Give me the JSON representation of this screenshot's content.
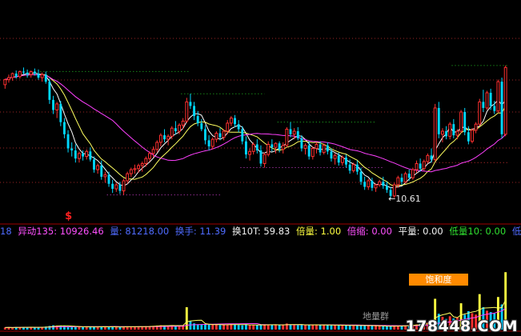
{
  "indicator_row": [
    {
      "name": "cut-prefix",
      "text": "18",
      "color": "#4f6bff"
    },
    {
      "name": "yidong-135",
      "text": "异动135: 10926.46",
      "color": "#ff50ff"
    },
    {
      "name": "volume-value",
      "text": "量: 81218.00",
      "color": "#4f6bff"
    },
    {
      "name": "turnover-value",
      "text": "换手: 11.39",
      "color": "#4f6bff"
    },
    {
      "name": "turnover-10t",
      "text": "换10T: 59.83",
      "color": "#f2f2f2"
    },
    {
      "name": "double-volume",
      "text": "倍量: 1.00",
      "color": "#ffff40"
    },
    {
      "name": "double-shrink",
      "text": "倍缩: 0.00",
      "color": "#ff50ff"
    },
    {
      "name": "flat-volume",
      "text": "平量: 0.00",
      "color": "#f2f2f2"
    },
    {
      "name": "low-volume-10",
      "text": "低量10: 0.00",
      "color": "#30e030"
    },
    {
      "name": "low-volume",
      "text": "低量",
      "color": "#4f6bff"
    }
  ],
  "annotations": {
    "low_price_label": "←10.61",
    "saturation_badge": "饱和度",
    "volume_group_label": "地量群",
    "signal_marker": "$",
    "watermark": "178448.COM"
  },
  "colors": {
    "up": "#ff3030",
    "down": "#00d8ff",
    "ma_short": "#ffffff",
    "ma_mid": "#ffff60",
    "ma_long": "#ff40ff",
    "dotted_green": "#22c022",
    "dotted_magenta": "#d040d0",
    "dotted_red": "#d03030",
    "divider": "#a00000",
    "volume_up": "#ff3030",
    "volume_down": "#00c8ff",
    "volume_highlight": "#ffff40",
    "volume_low_line": "#ff40ff",
    "volume_mid_line": "#ffff60"
  },
  "chart_data": {
    "type": "candlestick",
    "title": "",
    "xlabel": "",
    "ylabel": "",
    "ylim": [
      9.6,
      20.2
    ],
    "candles": [
      [
        16.25,
        16.55,
        16.05,
        16.5
      ],
      [
        16.5,
        16.75,
        16.35,
        16.6
      ],
      [
        16.6,
        16.85,
        16.45,
        16.8
      ],
      [
        16.8,
        16.95,
        16.55,
        16.65
      ],
      [
        16.65,
        16.95,
        16.55,
        16.9
      ],
      [
        16.9,
        17.1,
        16.75,
        16.85
      ],
      [
        16.85,
        17.0,
        16.6,
        16.75
      ],
      [
        16.75,
        16.95,
        16.6,
        16.9
      ],
      [
        16.9,
        17.05,
        16.7,
        16.8
      ],
      [
        16.8,
        17.0,
        16.5,
        16.6
      ],
      [
        16.6,
        16.85,
        16.4,
        16.75
      ],
      [
        16.75,
        16.9,
        16.3,
        16.4
      ],
      [
        16.4,
        16.55,
        15.3,
        15.5
      ],
      [
        15.5,
        15.7,
        14.8,
        15.0
      ],
      [
        15.0,
        15.4,
        14.6,
        15.3
      ],
      [
        15.3,
        15.45,
        14.2,
        14.4
      ],
      [
        14.4,
        14.6,
        13.6,
        13.8
      ],
      [
        13.8,
        14.0,
        12.9,
        13.1
      ],
      [
        13.1,
        13.4,
        12.7,
        13.0
      ],
      [
        13.0,
        13.3,
        12.4,
        12.6
      ],
      [
        12.6,
        12.95,
        12.4,
        12.85
      ],
      [
        12.85,
        13.0,
        12.5,
        12.7
      ],
      [
        12.7,
        13.05,
        12.55,
        12.95
      ],
      [
        12.95,
        13.15,
        12.45,
        12.55
      ],
      [
        12.55,
        12.7,
        11.9,
        12.05
      ],
      [
        12.05,
        12.35,
        11.85,
        12.25
      ],
      [
        12.25,
        12.5,
        11.55,
        11.7
      ],
      [
        11.7,
        11.95,
        11.4,
        11.8
      ],
      [
        11.8,
        11.95,
        11.2,
        11.35
      ],
      [
        11.35,
        11.55,
        10.9,
        11.1
      ],
      [
        11.1,
        11.4,
        10.95,
        11.3
      ],
      [
        11.3,
        11.45,
        10.85,
        11.0
      ],
      [
        11.0,
        11.6,
        10.8,
        11.5
      ],
      [
        11.5,
        11.95,
        11.35,
        11.85
      ],
      [
        11.85,
        12.15,
        11.7,
        12.05
      ],
      [
        12.05,
        12.3,
        11.85,
        12.1
      ],
      [
        12.1,
        12.35,
        11.9,
        12.25
      ],
      [
        12.25,
        12.45,
        11.95,
        12.35
      ],
      [
        12.35,
        12.7,
        12.2,
        12.6
      ],
      [
        12.6,
        12.95,
        12.45,
        12.85
      ],
      [
        12.85,
        13.2,
        12.65,
        13.05
      ],
      [
        13.05,
        13.5,
        12.9,
        13.4
      ],
      [
        13.4,
        13.85,
        13.2,
        13.75
      ],
      [
        13.75,
        14.05,
        13.4,
        13.55
      ],
      [
        13.55,
        13.8,
        13.25,
        13.7
      ],
      [
        13.7,
        14.2,
        13.55,
        14.1
      ],
      [
        14.1,
        14.45,
        13.8,
        13.95
      ],
      [
        13.95,
        14.35,
        13.8,
        14.25
      ],
      [
        14.25,
        14.6,
        14.05,
        14.45
      ],
      [
        14.45,
        15.6,
        14.35,
        15.4
      ],
      [
        15.4,
        15.8,
        15.05,
        15.2
      ],
      [
        15.2,
        15.4,
        14.5,
        14.7
      ],
      [
        14.7,
        14.95,
        14.2,
        14.35
      ],
      [
        14.35,
        14.55,
        13.95,
        14.05
      ],
      [
        14.05,
        14.25,
        13.3,
        13.5
      ],
      [
        13.5,
        13.75,
        13.0,
        13.2
      ],
      [
        13.2,
        13.65,
        13.05,
        13.55
      ],
      [
        13.55,
        13.95,
        13.4,
        13.85
      ],
      [
        13.85,
        14.1,
        13.5,
        13.65
      ],
      [
        13.65,
        14.05,
        13.5,
        13.95
      ],
      [
        13.95,
        14.5,
        13.8,
        14.35
      ],
      [
        14.35,
        14.7,
        14.2,
        14.6
      ],
      [
        14.6,
        14.75,
        14.15,
        14.3
      ],
      [
        14.3,
        14.5,
        13.9,
        14.05
      ],
      [
        14.05,
        14.2,
        13.3,
        13.45
      ],
      [
        13.45,
        13.7,
        12.6,
        12.8
      ],
      [
        12.8,
        13.1,
        12.5,
        12.95
      ],
      [
        12.95,
        13.4,
        12.8,
        13.3
      ],
      [
        13.3,
        13.55,
        12.85,
        13.0
      ],
      [
        13.0,
        13.25,
        12.2,
        12.35
      ],
      [
        12.35,
        12.9,
        12.15,
        12.8
      ],
      [
        12.8,
        13.45,
        12.7,
        13.3
      ],
      [
        13.3,
        13.55,
        12.95,
        13.15
      ],
      [
        13.15,
        13.4,
        12.85,
        13.35
      ],
      [
        13.35,
        13.45,
        12.9,
        13.05
      ],
      [
        13.05,
        13.4,
        12.85,
        13.25
      ],
      [
        13.25,
        14.15,
        13.15,
        14.05
      ],
      [
        14.05,
        14.4,
        13.65,
        13.8
      ],
      [
        13.8,
        14.1,
        13.55,
        13.95
      ],
      [
        13.95,
        14.15,
        13.5,
        13.6
      ],
      [
        13.6,
        13.75,
        12.95,
        13.1
      ],
      [
        13.1,
        13.35,
        12.8,
        13.25
      ],
      [
        13.25,
        13.45,
        12.55,
        12.7
      ],
      [
        12.7,
        13.2,
        12.55,
        13.1
      ],
      [
        13.1,
        13.4,
        12.85,
        13.3
      ],
      [
        13.3,
        13.45,
        12.75,
        12.9
      ],
      [
        12.9,
        13.35,
        12.8,
        13.25
      ],
      [
        13.25,
        13.4,
        12.8,
        12.95
      ],
      [
        12.95,
        13.1,
        12.45,
        12.6
      ],
      [
        12.6,
        12.85,
        12.3,
        12.75
      ],
      [
        12.75,
        12.9,
        12.25,
        12.4
      ],
      [
        12.4,
        12.75,
        12.25,
        12.65
      ],
      [
        12.65,
        12.8,
        12.15,
        12.3
      ],
      [
        12.3,
        12.55,
        11.85,
        12.0
      ],
      [
        12.0,
        12.4,
        11.9,
        12.3
      ],
      [
        12.3,
        12.5,
        11.8,
        11.95
      ],
      [
        11.95,
        12.15,
        11.3,
        11.45
      ],
      [
        11.45,
        11.7,
        11.05,
        11.2
      ],
      [
        11.2,
        11.6,
        11.05,
        11.5
      ],
      [
        11.5,
        11.65,
        11.0,
        11.15
      ],
      [
        11.15,
        11.35,
        10.95,
        11.3
      ],
      [
        11.3,
        11.55,
        11.2,
        11.45
      ],
      [
        11.45,
        11.7,
        11.1,
        11.25
      ],
      [
        11.25,
        11.45,
        10.9,
        11.05
      ],
      [
        11.05,
        11.2,
        10.61,
        10.75
      ],
      [
        10.75,
        11.4,
        10.65,
        11.3
      ],
      [
        11.3,
        11.75,
        11.15,
        11.65
      ],
      [
        11.65,
        11.85,
        11.3,
        11.45
      ],
      [
        11.45,
        11.95,
        11.35,
        11.85
      ],
      [
        11.85,
        12.05,
        11.5,
        11.65
      ],
      [
        11.65,
        12.15,
        11.55,
        12.05
      ],
      [
        12.05,
        12.5,
        11.9,
        12.35
      ],
      [
        12.35,
        12.6,
        11.95,
        12.1
      ],
      [
        12.1,
        12.55,
        12.0,
        12.45
      ],
      [
        12.45,
        12.85,
        12.35,
        12.75
      ],
      [
        12.75,
        13.1,
        12.4,
        12.55
      ],
      [
        12.55,
        15.3,
        12.45,
        15.1
      ],
      [
        15.1,
        15.4,
        13.6,
        13.8
      ],
      [
        13.8,
        14.1,
        13.4,
        13.95
      ],
      [
        13.95,
        14.2,
        13.55,
        13.7
      ],
      [
        13.7,
        14.4,
        13.55,
        14.3
      ],
      [
        14.3,
        14.55,
        13.6,
        13.75
      ],
      [
        13.75,
        14.05,
        13.55,
        13.95
      ],
      [
        13.95,
        15.0,
        13.85,
        14.9
      ],
      [
        14.9,
        15.1,
        13.75,
        13.9
      ],
      [
        13.9,
        14.2,
        13.3,
        13.45
      ],
      [
        13.45,
        14.1,
        13.35,
        14.0
      ],
      [
        14.0,
        14.4,
        13.85,
        14.3
      ],
      [
        14.3,
        15.55,
        14.2,
        15.4
      ],
      [
        15.4,
        16.0,
        14.9,
        15.1
      ],
      [
        15.1,
        15.95,
        15.0,
        15.85
      ],
      [
        15.85,
        16.05,
        15.0,
        15.2
      ],
      [
        15.2,
        15.45,
        14.8,
        14.95
      ],
      [
        14.95,
        16.5,
        14.85,
        16.4
      ],
      [
        16.4,
        16.6,
        13.6,
        13.8
      ],
      [
        13.8,
        17.2,
        13.7,
        17.1
      ]
    ],
    "volume_ylim": [
      0,
      72000
    ],
    "volume": [
      2500,
      2600,
      2400,
      3000,
      2800,
      2700,
      2600,
      2900,
      2800,
      2500,
      3100,
      3600,
      4300,
      5100,
      4800,
      4400,
      4200,
      3900,
      3600,
      3200,
      3400,
      3000,
      3300,
      3100,
      3500,
      3200,
      3700,
      3400,
      3000,
      3300,
      3100,
      2900,
      3600,
      3800,
      3500,
      3400,
      3700,
      3600,
      3900,
      4100,
      4300,
      4800,
      5200,
      4600,
      4400,
      5000,
      4700,
      4900,
      5100,
      26500,
      9800,
      7400,
      6200,
      5800,
      6500,
      5900,
      5600,
      5800,
      5400,
      5700,
      6200,
      6600,
      5900,
      5500,
      5100,
      6400,
      5200,
      5600,
      5300,
      5900,
      5700,
      6100,
      5400,
      5600,
      5200,
      5500,
      7200,
      6100,
      5600,
      5400,
      5800,
      5200,
      6000,
      5500,
      5700,
      5300,
      5600,
      5400,
      5100,
      5300,
      5000,
      5200,
      4800,
      4900,
      4700,
      4600,
      5100,
      4800,
      4600,
      4500,
      4300,
      4200,
      4100,
      3900,
      3800,
      4600,
      4400,
      4700,
      4900,
      5200,
      5600,
      6100,
      6800,
      7400,
      8200,
      9100,
      36500,
      18800,
      15200,
      12600,
      15800,
      13200,
      14400,
      31200,
      17600,
      21800,
      19400,
      17800,
      42000,
      26600,
      22400,
      20800,
      19200,
      38600,
      29800,
      68000
    ],
    "volume_highlight_indices": [
      49,
      116,
      123,
      128,
      133,
      135
    ],
    "signal_marker_index": 17,
    "low_price_index": 104
  }
}
